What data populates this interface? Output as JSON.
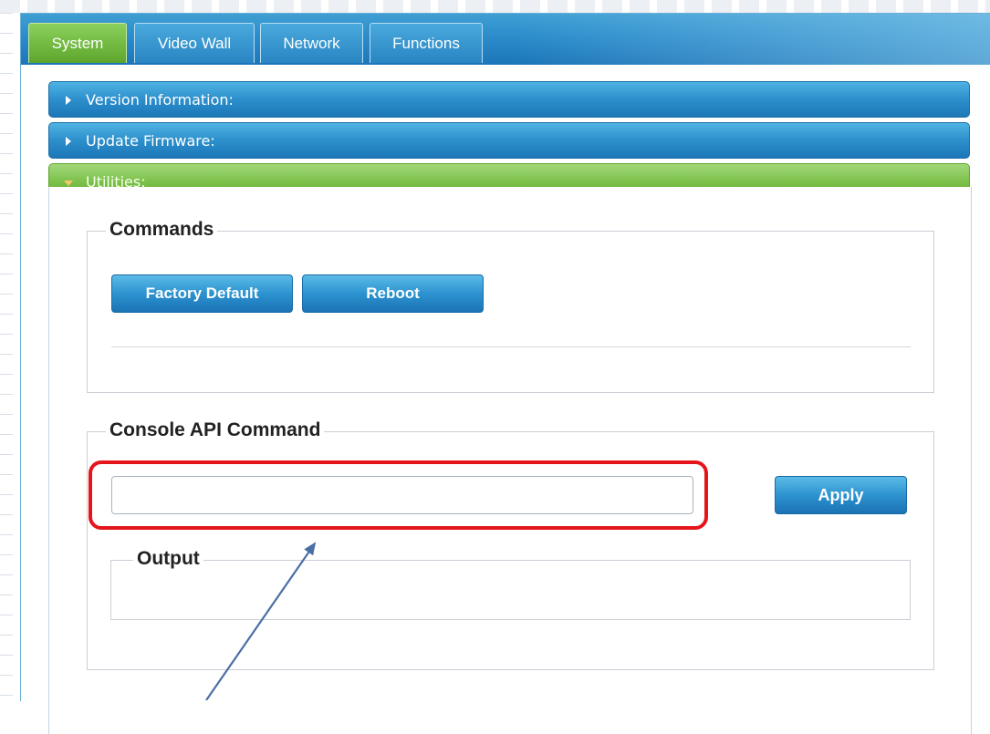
{
  "tabs": [
    {
      "label": "System",
      "active": true
    },
    {
      "label": "Video Wall",
      "active": false
    },
    {
      "label": "Network",
      "active": false
    },
    {
      "label": "Functions",
      "active": false
    }
  ],
  "sections": {
    "version": {
      "label": "Version Information:",
      "expanded": false
    },
    "firmware": {
      "label": "Update Firmware:",
      "expanded": false
    },
    "utilities": {
      "label": "Utilities:",
      "expanded": true
    }
  },
  "commands": {
    "legend": "Commands",
    "factory_default_label": "Factory Default",
    "reboot_label": "Reboot"
  },
  "console": {
    "legend": "Console API Command",
    "input_value": "",
    "apply_label": "Apply",
    "output_legend": "Output",
    "output_value": ""
  },
  "colors": {
    "active_tab": "#6cb83d",
    "tab": "#2d8fd0",
    "highlight": "#e4161b",
    "annotation_arrow": "#4a6fa5"
  },
  "icons": {
    "collapsed": "caret-right-icon",
    "expanded": "caret-down-icon"
  }
}
